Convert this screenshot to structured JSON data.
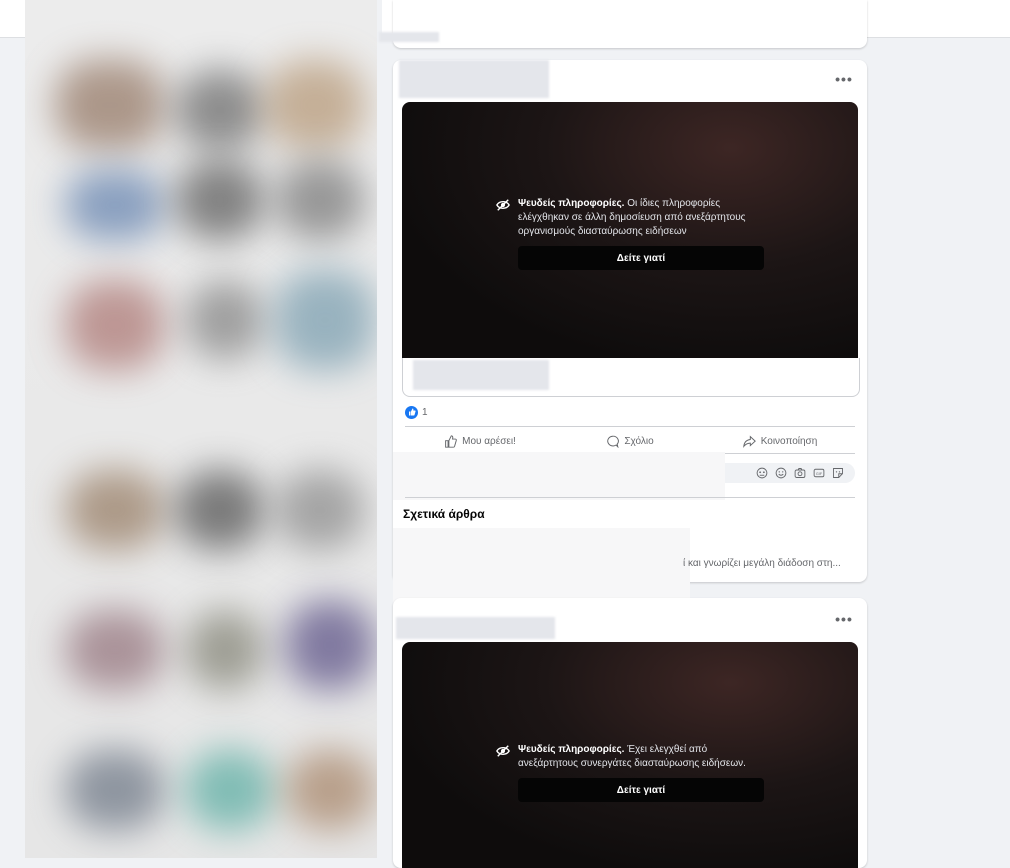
{
  "topbar": {
    "more_label": "•••"
  },
  "post_1": {
    "more_label": "•••",
    "warning": {
      "title": "Ψευδείς πληροφορίες.",
      "text": "Οι ίδιες πληροφορίες ελέγχθηκαν σε άλλη δημοσίευση από ανεξάρτητους οργανισμούς διασταύρωσης ειδήσεων",
      "button": "Δείτε γιατί"
    },
    "reaction_count": "1",
    "actions": {
      "like": "Μου αρέσει!",
      "comment": "Σχόλιο",
      "share": "Κοινοποίηση"
    },
    "related": {
      "title": "Σχετικά άρθρα",
      "snippet": "ί και γνωρίζει μεγάλη διάδοση στη..."
    }
  },
  "post_2": {
    "more_label": "•••",
    "warning": {
      "title": "Ψευδείς πληροφορίες.",
      "text": "Έχει ελεγχθεί από ανεξάρτητους συνεργάτες διασταύρωσης ειδήσεων.",
      "button": "Δείτε γιατί"
    }
  },
  "colors": {
    "like_blue": "#1877f2",
    "background": "#f0f2f5",
    "button_dark": "#050505"
  }
}
